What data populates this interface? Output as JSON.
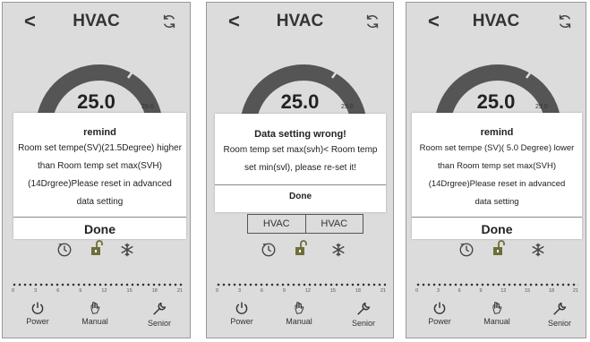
{
  "screens": [
    {
      "back_glyph": "<",
      "title": "HVAC",
      "temperature": "25.0",
      "small_temp": "29.0",
      "modal": {
        "title": "remind",
        "body_lines": [
          "Room set tempe(SV)(21.5Degree) higher",
          "than Room temp set max(SVH)",
          "(14Drgree)Please reset in advanced",
          "data setting"
        ],
        "done_label": "Done"
      },
      "time_ticks": [
        "0",
        "3",
        "6",
        "9",
        "12",
        "15",
        "18",
        "21"
      ],
      "bottom_nav": {
        "power": "Power",
        "manual": "Manual",
        "senior": "Senior"
      }
    },
    {
      "back_glyph": "<",
      "title": "HVAC",
      "temperature": "25.0",
      "small_temp": "29.0",
      "modal": {
        "title": "Data setting wrong!",
        "body_lines": [
          "Room temp set max(svh)< Room temp",
          "set min(svl), please re-set it!"
        ],
        "done_label": "Done"
      },
      "hvac_buttons": [
        "HVAC",
        "HVAC"
      ],
      "time_ticks": [
        "0",
        "3",
        "6",
        "9",
        "12",
        "15",
        "18",
        "21"
      ],
      "bottom_nav": {
        "power": "Power",
        "manual": "Manual",
        "senior": "Senior"
      }
    },
    {
      "back_glyph": "<",
      "title": "HVAC",
      "temperature": "25.0",
      "small_temp": "29.0",
      "modal": {
        "title": "remind",
        "body_lines": [
          "Room set tempe  (SV)( 5.0 Degree) lower",
          "than Room temp set max(SVH)",
          "(14Drgree)Please reset in advanced",
          "data setting"
        ],
        "done_label": "Done"
      },
      "time_ticks": [
        "0",
        "3",
        "6",
        "9",
        "12",
        "15",
        "18",
        "21"
      ],
      "bottom_nav": {
        "power": "Power",
        "manual": "Manual",
        "senior": "Senior"
      }
    }
  ],
  "colors": {
    "screen_bg": "#dcdcdc",
    "gauge_arc": "#555555",
    "lock_icon": "#6e6e3a",
    "modal_bg": "#ffffff"
  }
}
